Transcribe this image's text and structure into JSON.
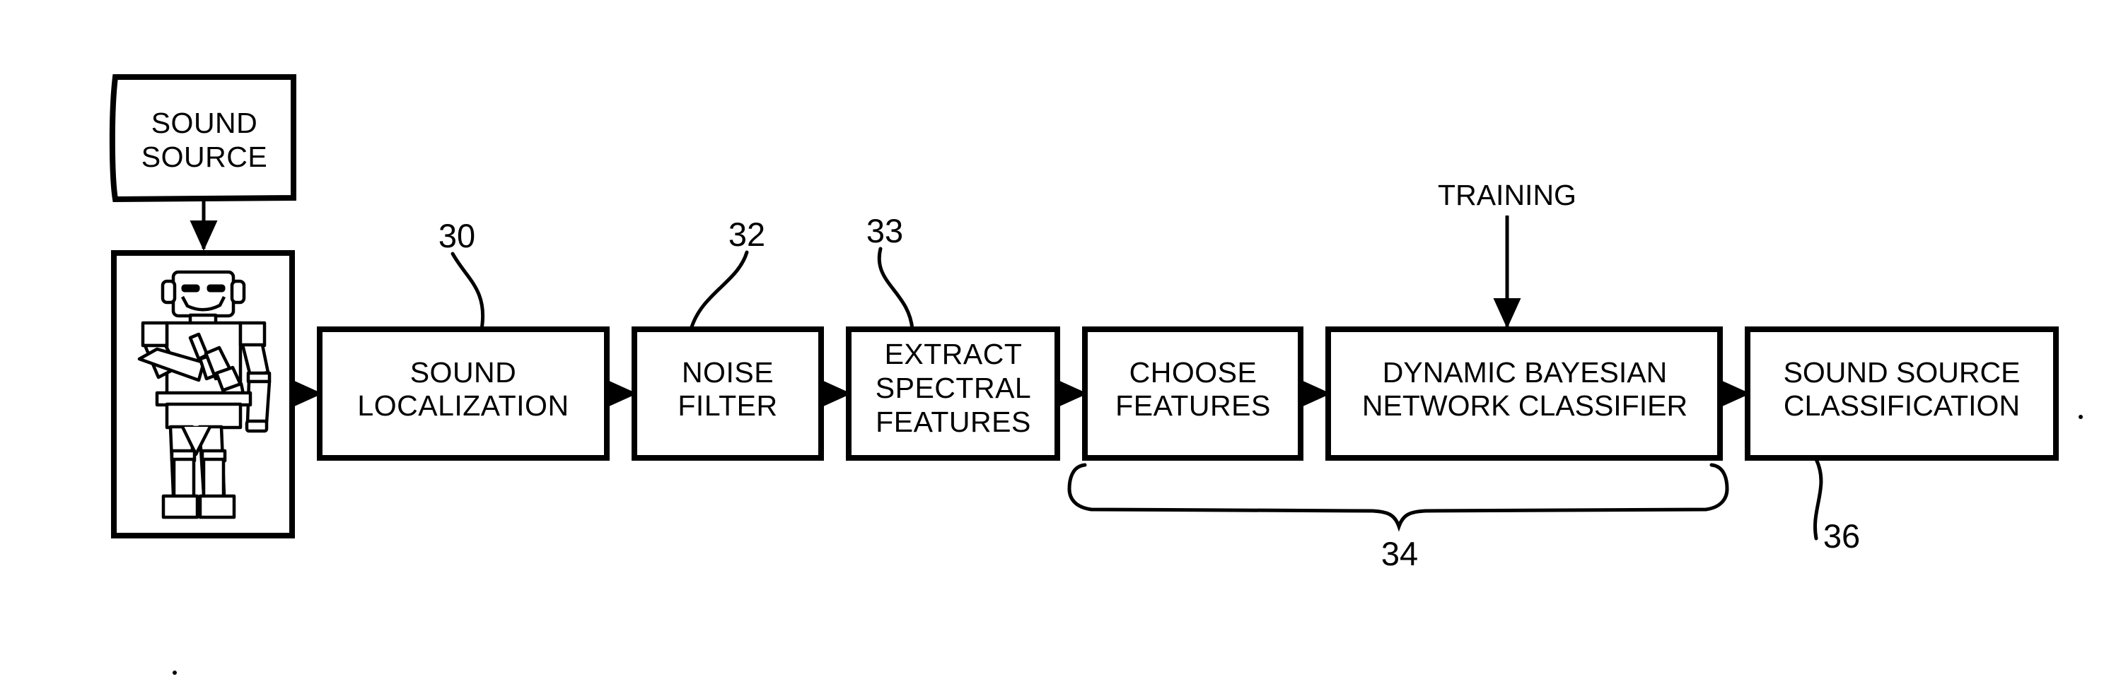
{
  "figure": {
    "type": "patent-flow-diagram",
    "title": "Sound source classification process flow"
  },
  "blocks": {
    "sound_source": {
      "line1": "SOUND",
      "line2": "SOURCE"
    },
    "robot_panel": {
      "icon": "robot-with-megaphone"
    },
    "sound_localization": {
      "line1": "SOUND",
      "line2": "LOCALIZATION",
      "ref": "30"
    },
    "noise_filter": {
      "line1": "NOISE",
      "line2": "FILTER",
      "ref": "32"
    },
    "extract_spectral_features": {
      "line1": "EXTRACT",
      "line2": "SPECTRAL",
      "line3": "FEATURES",
      "ref": "33"
    },
    "choose_features": {
      "line1": "CHOOSE",
      "line2": "FEATURES"
    },
    "dbn_classifier": {
      "line1": "DYNAMIC BAYESIAN",
      "line2": "NETWORK CLASSIFIER"
    },
    "sound_source_classification": {
      "line1": "SOUND SOURCE",
      "line2": "CLASSIFICATION",
      "ref": "36"
    }
  },
  "annotations": {
    "training": "TRAINING",
    "brace_ref": "34"
  },
  "colors": {
    "ink": "#000000",
    "paper": "#ffffff"
  },
  "icons": {
    "arrow": "arrow-right-icon",
    "arrow_down": "arrow-down-icon",
    "brace": "curly-brace-icon",
    "leader": "leader-line-icon"
  }
}
